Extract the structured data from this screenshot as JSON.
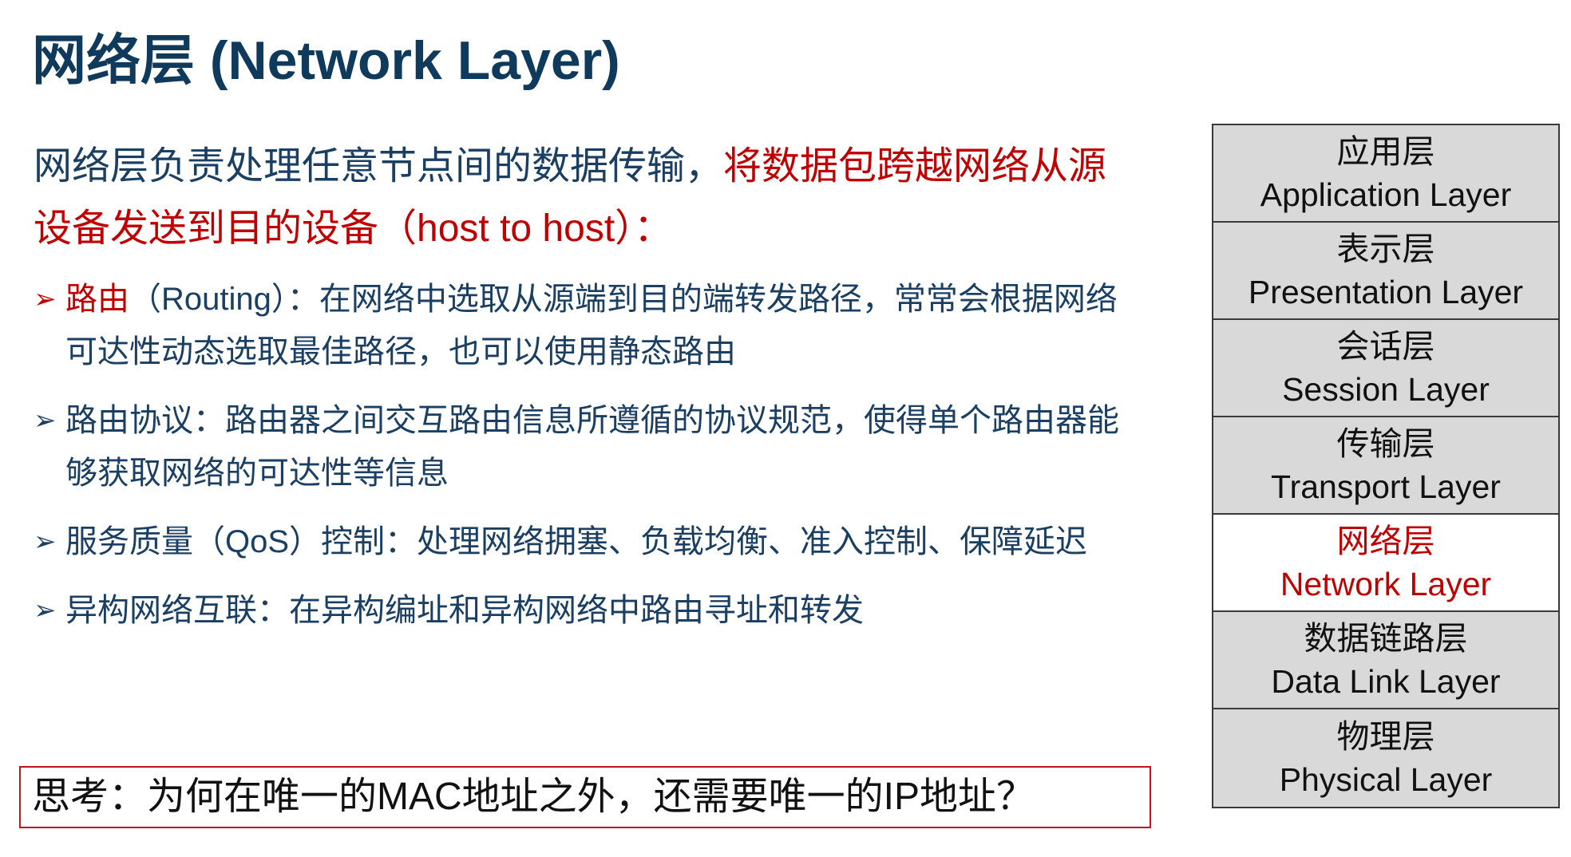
{
  "slide": {
    "title": "网络层 (Network Layer)",
    "intro": {
      "normal": "网络层负责处理任意节点间的数据传输，",
      "highlight": "将数据包跨越网络从源设备发送到目的设备（host to host）："
    },
    "bullets": [
      {
        "highlight": "路由",
        "text": "（Routing）：在网络中选取从源端到目的端转发路径，常常会根据网络可达性动态选取最佳路径，也可以使用静态路由"
      },
      {
        "highlight": "",
        "text": "路由协议：路由器之间交互路由信息所遵循的协议规范，使得单个路由器能够获取网络的可达性等信息"
      },
      {
        "highlight": "",
        "text": "服务质量（QoS）控制：处理网络拥塞、负载均衡、准入控制、保障延迟"
      },
      {
        "highlight": "",
        "text": "异构网络互联：在异构编址和异构网络中路由寻址和转发"
      }
    ],
    "think": "思考：为何在唯一的MAC地址之外，还需要唯一的IP地址？"
  },
  "stack": {
    "layers": [
      {
        "zh": "应用层",
        "en": "Application Layer"
      },
      {
        "zh": "表示层",
        "en": "Presentation Layer"
      },
      {
        "zh": "会话层",
        "en": "Session Layer"
      },
      {
        "zh": "传输层",
        "en": "Transport Layer"
      },
      {
        "zh": "网络层",
        "en": "Network Layer"
      },
      {
        "zh": "数据链路层",
        "en": "Data Link Layer"
      },
      {
        "zh": "物理层",
        "en": "Physical Layer"
      }
    ],
    "active_index": 4
  },
  "colors": {
    "title": "#0f3a5c",
    "body": "#1b3f63",
    "highlight": "#c00000",
    "layer_bg": "#d9d9d9"
  }
}
